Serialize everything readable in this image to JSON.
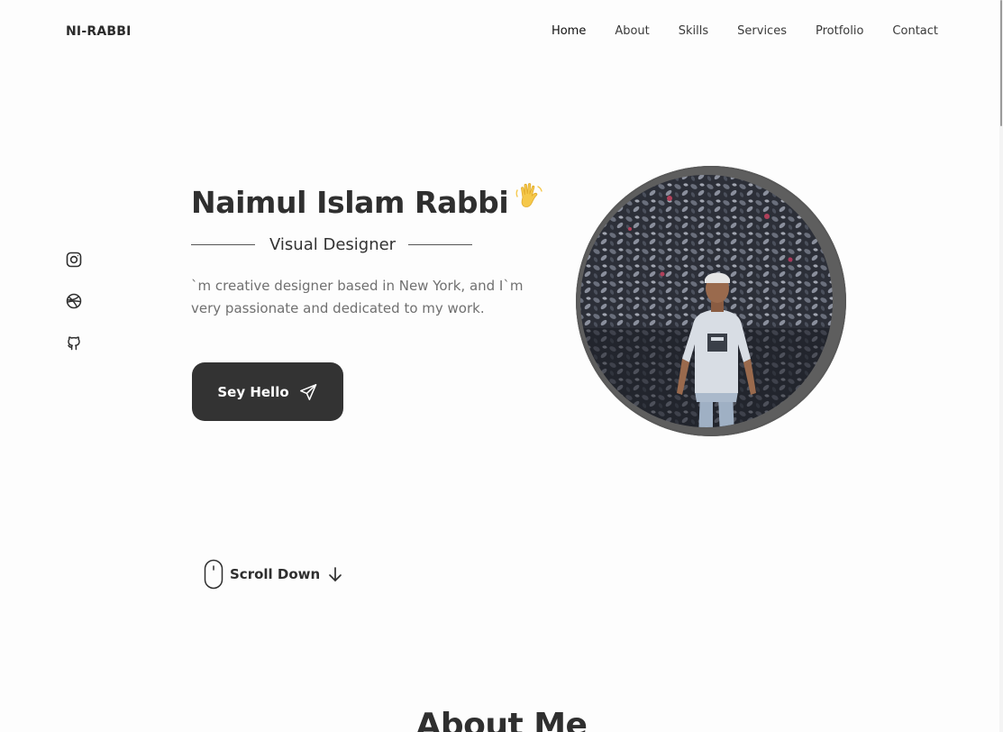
{
  "header": {
    "logo": "NI-RABBI",
    "nav": [
      {
        "label": "Home",
        "active": true
      },
      {
        "label": "About"
      },
      {
        "label": "Skills"
      },
      {
        "label": "Services"
      },
      {
        "label": "Protfolio"
      },
      {
        "label": "Contact"
      }
    ]
  },
  "social": [
    {
      "icon": "instagram-icon"
    },
    {
      "icon": "dribbble-icon"
    },
    {
      "icon": "github-icon"
    }
  ],
  "hero": {
    "name": "Naimul Islam Rabbi",
    "wave_icon": "waving-hand-icon",
    "subtitle": "Visual Designer",
    "description": "`m creative designer based in New York, and I`m very passionate and dedicated to my work.",
    "cta_label": "Sey Hello",
    "cta_icon": "send-icon"
  },
  "scroll": {
    "label": "Scroll Down",
    "icons": [
      "mouse-icon",
      "arrow-down-icon"
    ]
  },
  "next_section": {
    "title": "About Me"
  },
  "colors": {
    "background": "#fdfdfd",
    "text_dark": "#333333",
    "text_muted": "#707070",
    "button_bg": "#333333",
    "wave_emoji": "#f5c84a"
  }
}
